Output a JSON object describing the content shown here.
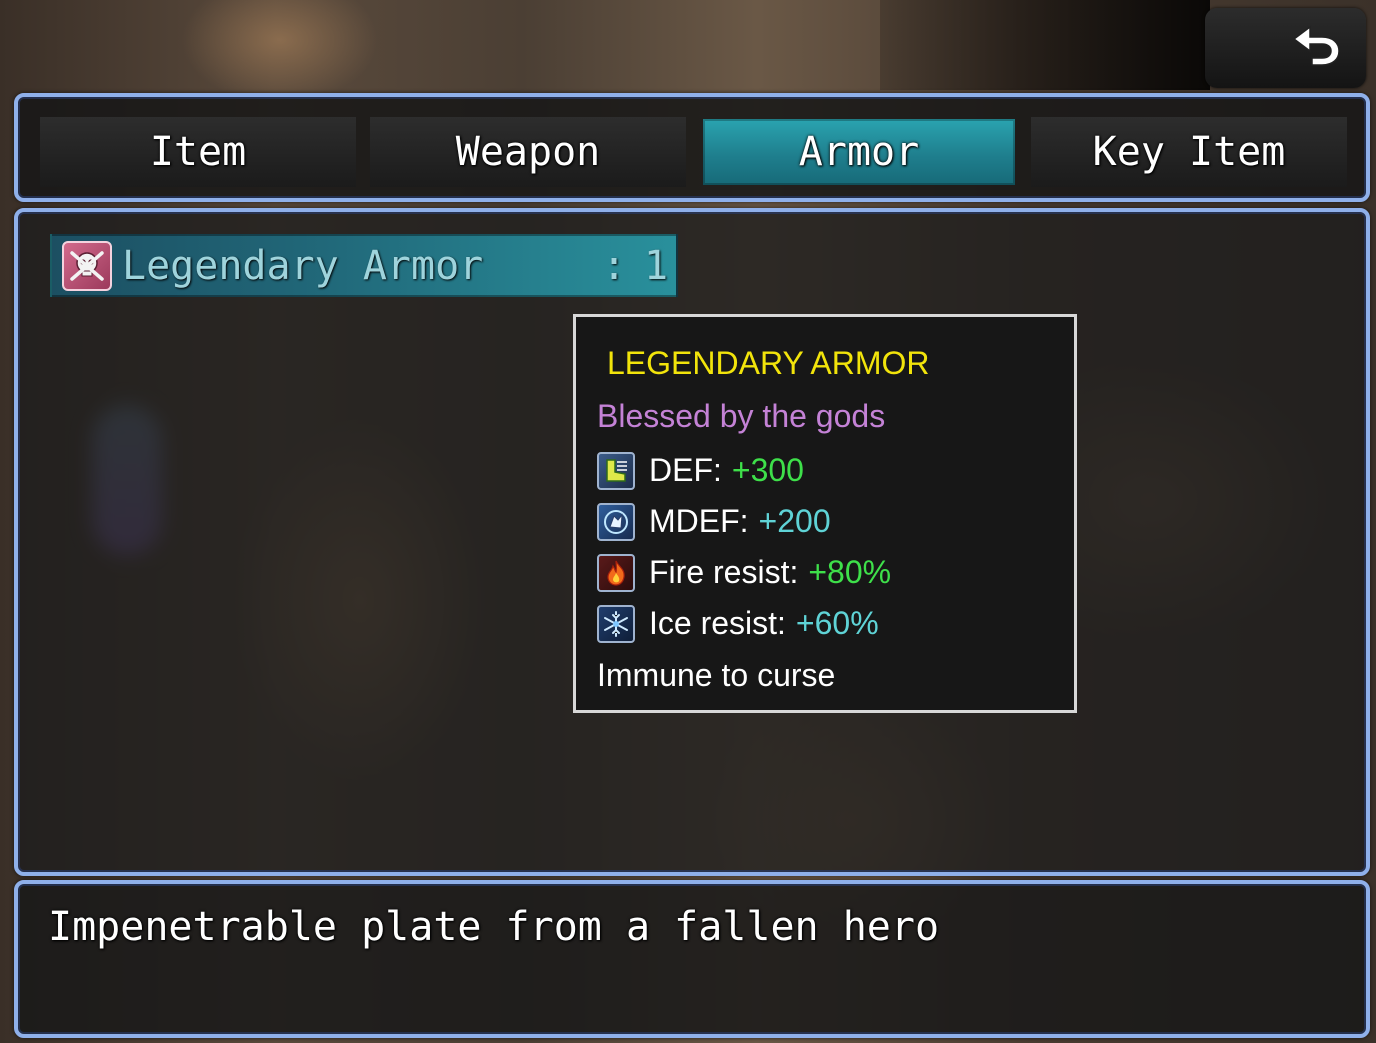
{
  "tabs": [
    {
      "label": "Item",
      "selected": false
    },
    {
      "label": "Weapon",
      "selected": false
    },
    {
      "label": "Armor",
      "selected": true
    },
    {
      "label": "Key Item",
      "selected": false
    }
  ],
  "back_button": {
    "icon": "back-arrow-icon"
  },
  "item_list": [
    {
      "name": "Legendary Armor",
      "separator": ":",
      "count": "1",
      "icon": "skull-armor-icon"
    }
  ],
  "tooltip": {
    "title": "LEGENDARY ARMOR",
    "subtitle": "Blessed by the gods",
    "stats": [
      {
        "label": "DEF:",
        "value": "+300",
        "icon": "defense-boot-icon",
        "value_color": "#3ee04a"
      },
      {
        "label": "MDEF:",
        "value": "+200",
        "icon": "magic-defense-icon",
        "value_color": "#5fd3d6"
      },
      {
        "label": "Fire resist:",
        "value": "+80%",
        "icon": "fire-icon",
        "value_color": "#3ee04a"
      },
      {
        "label": "Ice resist:",
        "value": "+60%",
        "icon": "ice-icon",
        "value_color": "#5fd3d6"
      }
    ],
    "note": "Immune to curse",
    "title_color": "#f2e40b",
    "subtitle_color": "#c482d6"
  },
  "help": {
    "description": "Impenetrable plate from a fallen hero"
  },
  "colors": {
    "window_border": "#8fb0ea",
    "selected_tab": "#2aa4b0"
  }
}
